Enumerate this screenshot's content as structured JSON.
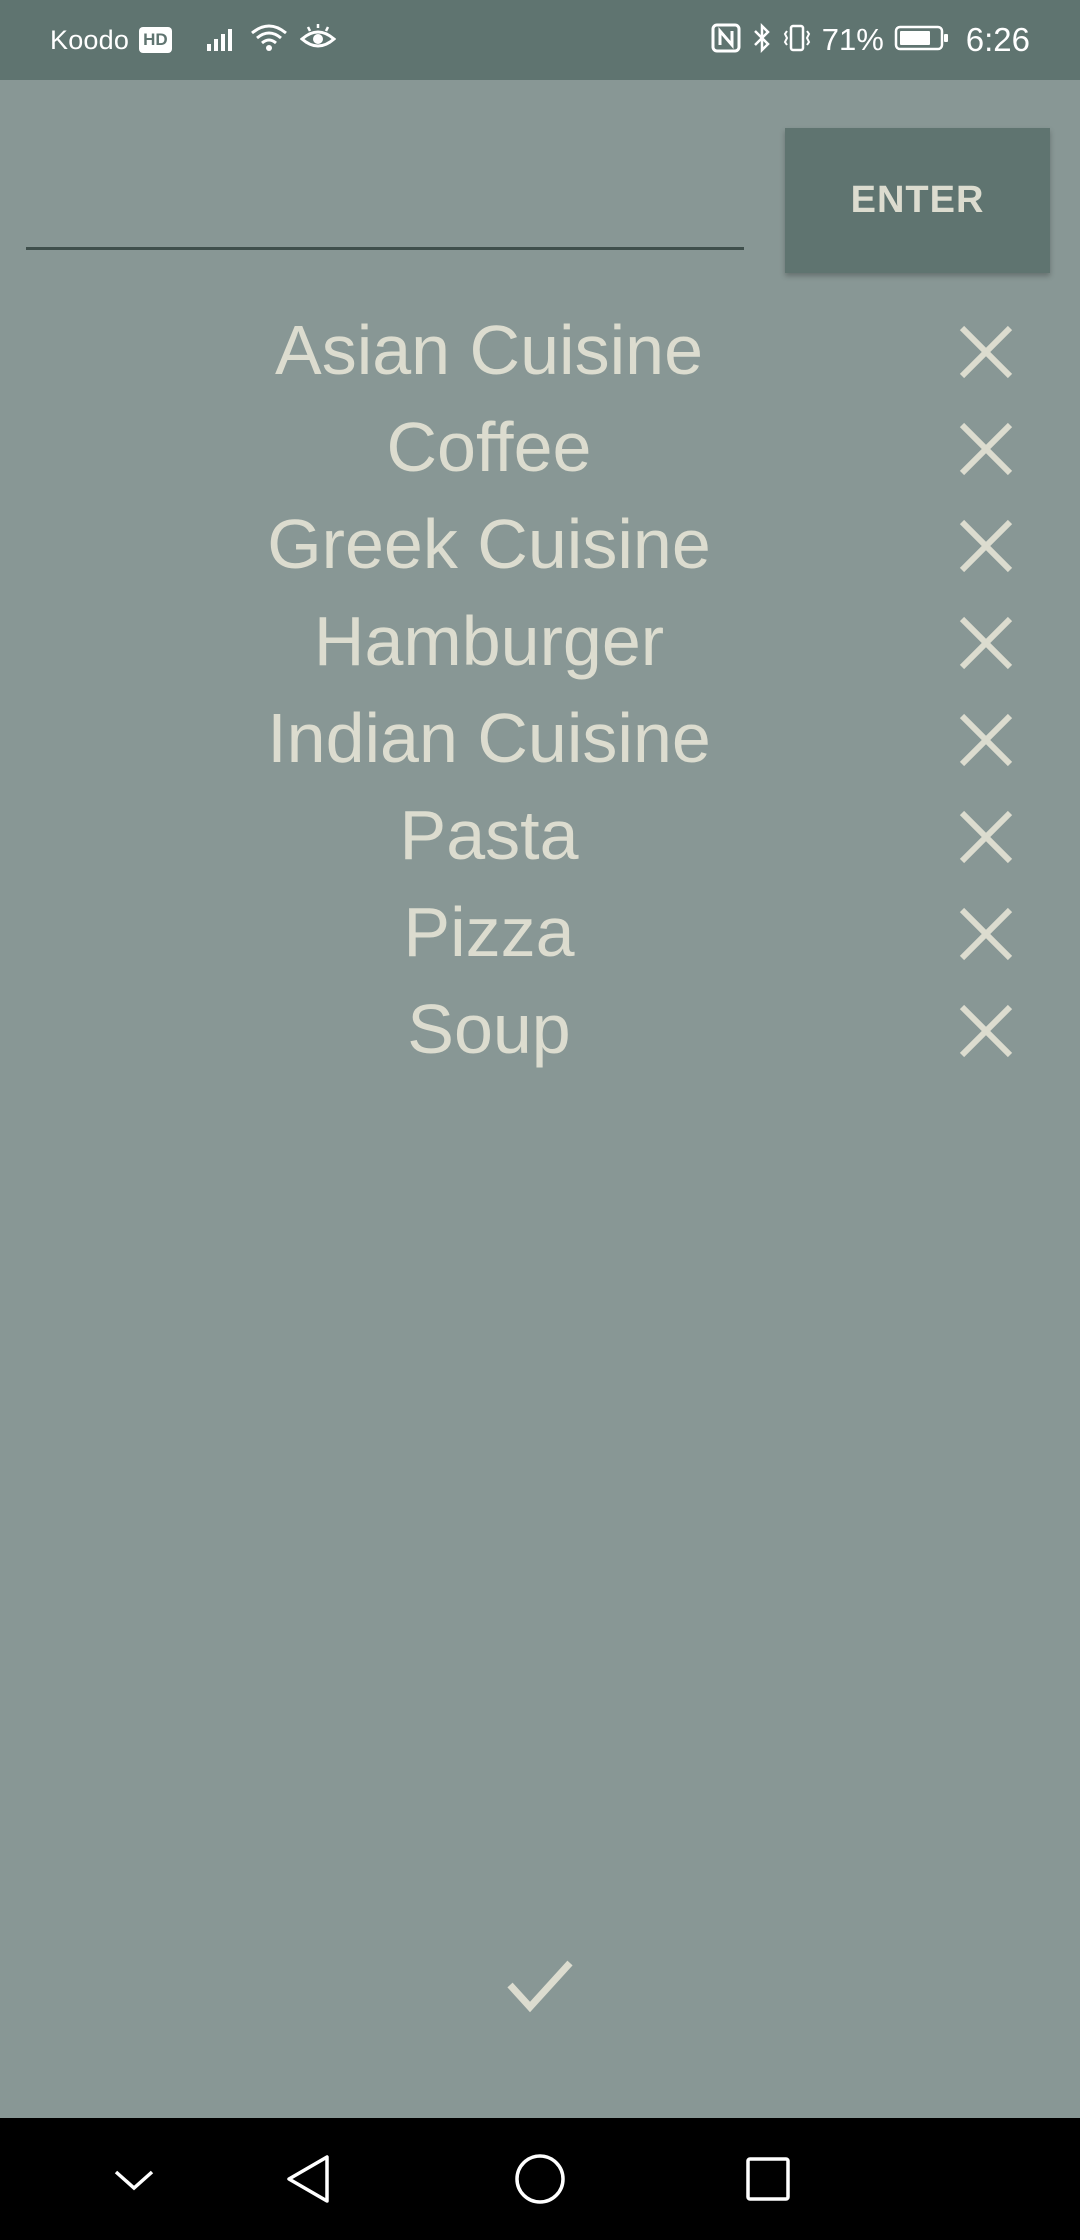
{
  "status_bar": {
    "carrier": "Koodo",
    "hd_badge": "HD",
    "battery_percent": "71%",
    "time": "6:26"
  },
  "input": {
    "value": "",
    "placeholder": ""
  },
  "enter_button": {
    "label": "ENTER"
  },
  "items": [
    {
      "label": "Asian Cuisine"
    },
    {
      "label": "Coffee"
    },
    {
      "label": "Greek Cuisine"
    },
    {
      "label": "Hamburger"
    },
    {
      "label": "Indian Cuisine"
    },
    {
      "label": "Pasta"
    },
    {
      "label": "Pizza"
    },
    {
      "label": "Soup"
    }
  ],
  "icons": {
    "delete": "close-icon",
    "confirm": "check-icon"
  },
  "colors": {
    "background": "#889795",
    "bar": "#5f7470",
    "text": "#dcdccf"
  }
}
